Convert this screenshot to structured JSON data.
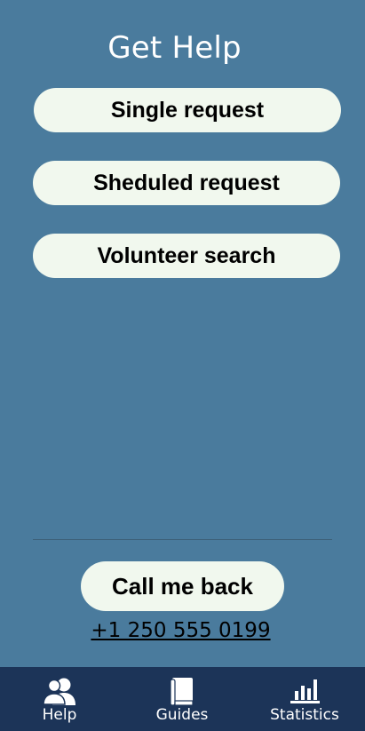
{
  "header": {
    "title": "Get Help"
  },
  "actions": {
    "single_request": "Single request",
    "scheduled_request": "Sheduled request",
    "volunteer_search": "Volunteer search"
  },
  "callback": {
    "button_label": "Call me back",
    "phone_number": "+1 250 555 0199"
  },
  "nav": {
    "items": [
      {
        "label": "Help",
        "icon": "people-icon"
      },
      {
        "label": "Guides",
        "icon": "book-icon"
      },
      {
        "label": "Statistics",
        "icon": "bar-chart-icon"
      }
    ]
  },
  "colors": {
    "background": "#4a7b9d",
    "button": "#f1f8ee",
    "nav_background": "#1c3458"
  }
}
